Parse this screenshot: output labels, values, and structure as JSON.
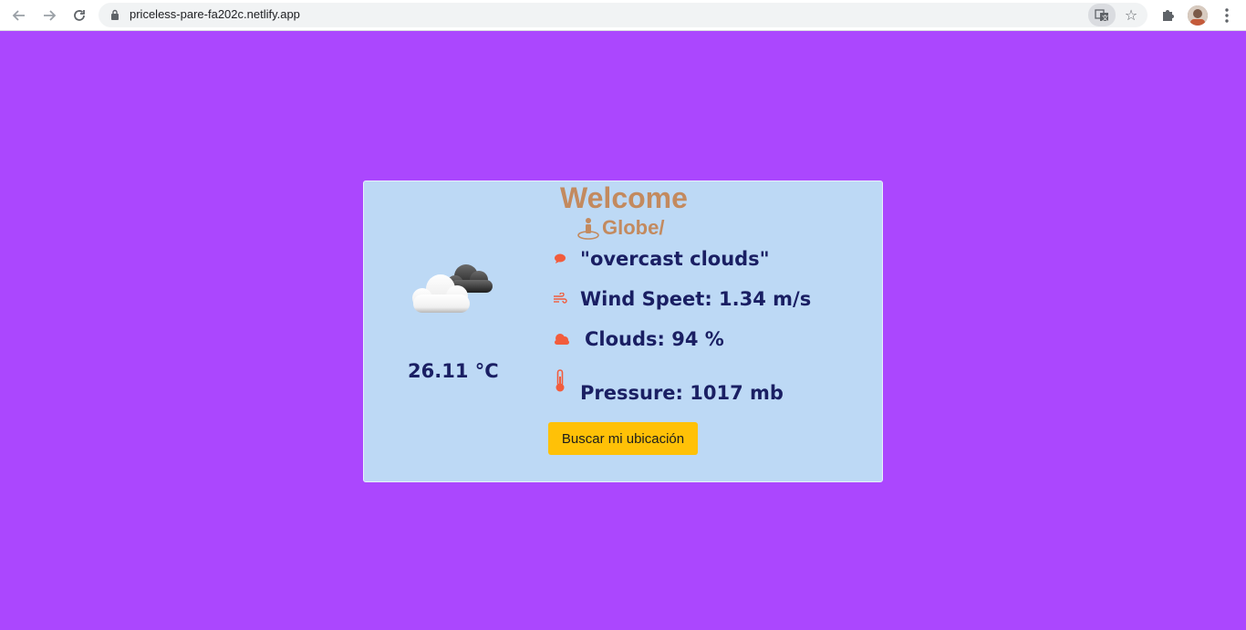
{
  "browser": {
    "url": "priceless-pare-fa202c.netlify.app"
  },
  "card": {
    "welcome": "Welcome",
    "globe_label": "Globe/",
    "weather_icon": "overcast-cloud-icon",
    "temperature": "26.11 °C",
    "description": "\"overcast clouds\"",
    "wind": "Wind Speet: 1.34 m/s",
    "clouds": "Clouds: 94 %",
    "pressure": "Pressure: 1017 mb",
    "button_label": "Buscar mi ubicación"
  },
  "colors": {
    "page_bg": "#ab47fe",
    "card_bg": "#bdd9f5",
    "heading": "#c38a5f",
    "text": "#1a1f63",
    "icon": "#f25c3c",
    "button": "#ffc107"
  }
}
